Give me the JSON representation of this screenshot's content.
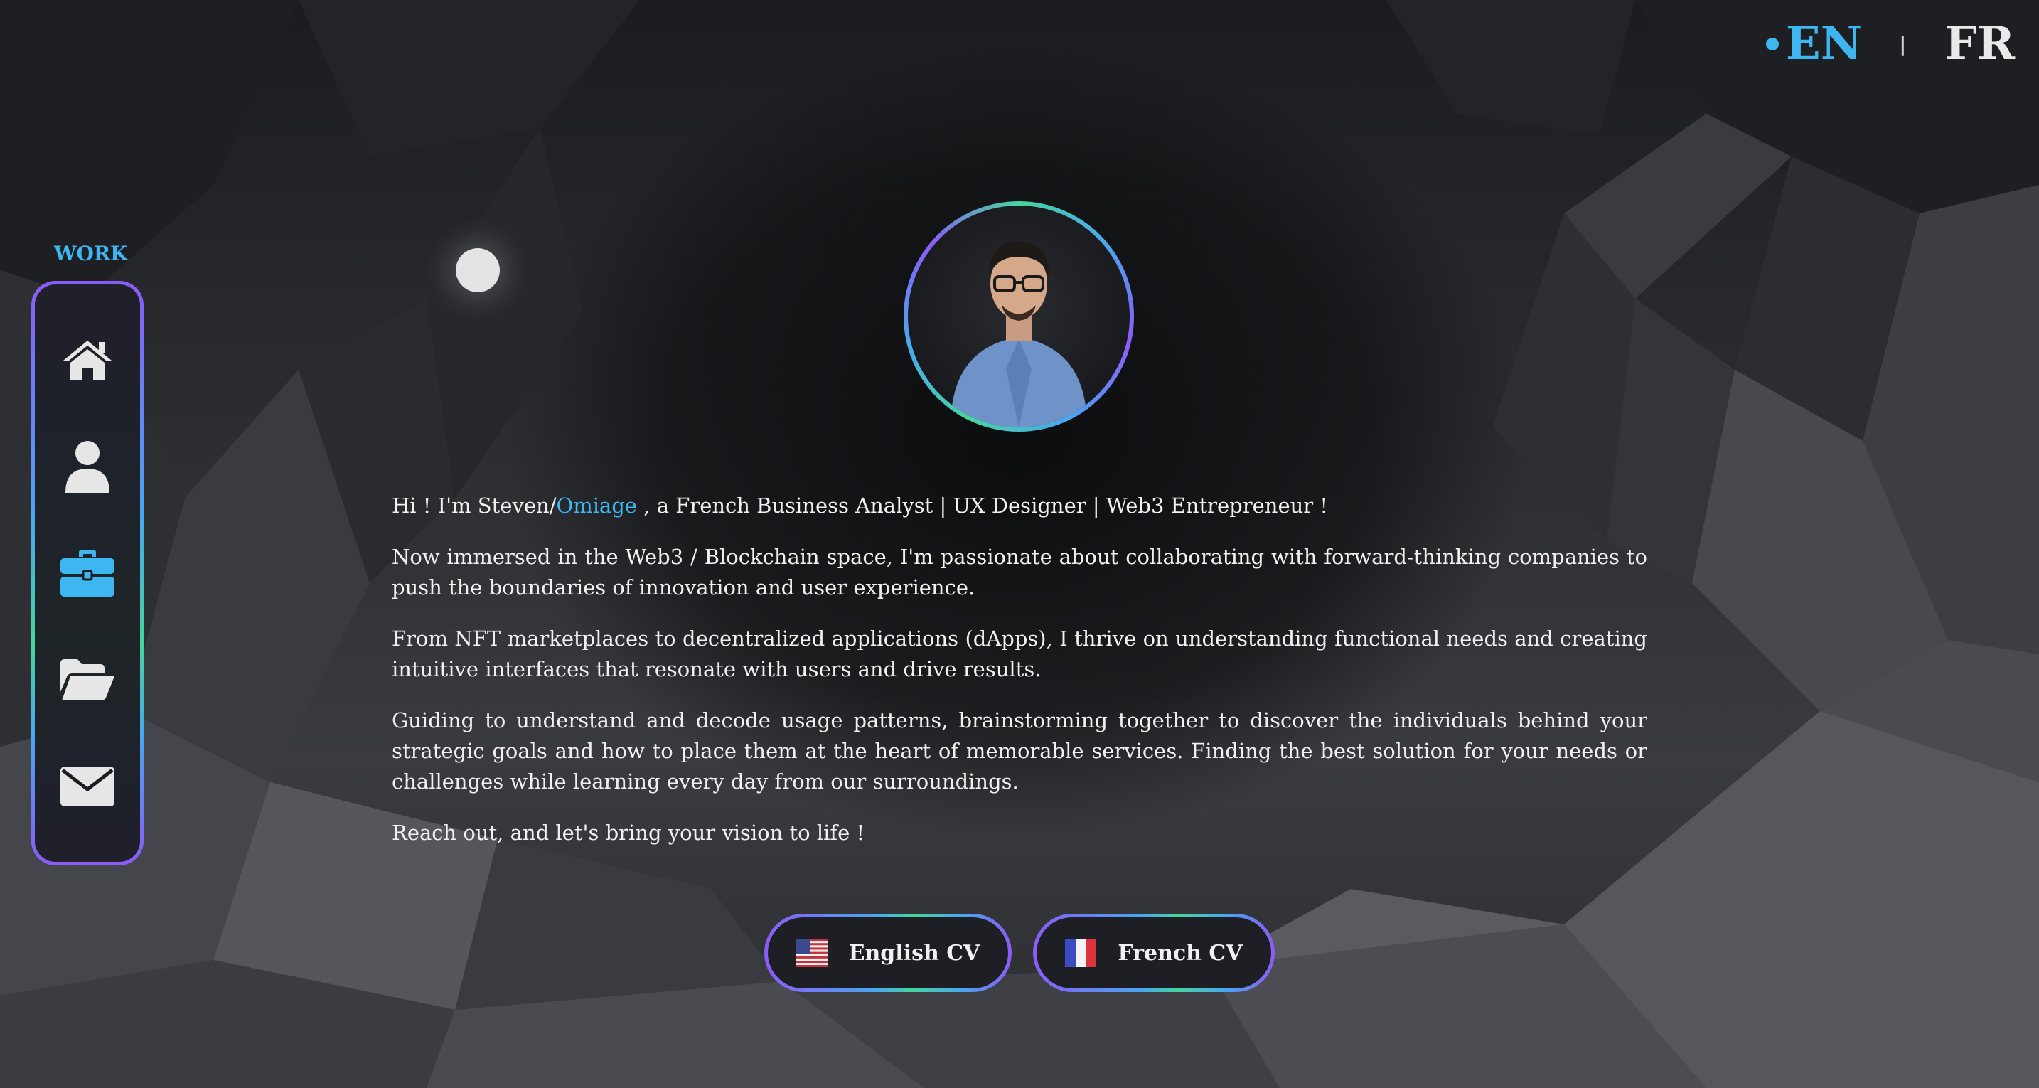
{
  "language_switch": {
    "active": "EN",
    "other": "FR"
  },
  "sidebar": {
    "section_label": "WORK",
    "items": [
      {
        "name": "home",
        "icon": "home-icon",
        "active": false
      },
      {
        "name": "about",
        "icon": "user-icon",
        "active": false
      },
      {
        "name": "work",
        "icon": "briefcase-icon",
        "active": true
      },
      {
        "name": "portfolio",
        "icon": "folder-open-icon",
        "active": false
      },
      {
        "name": "contact",
        "icon": "envelope-icon",
        "active": false
      }
    ]
  },
  "bio": {
    "intro_prefix": "Hi ! I'm Steven/",
    "intro_name": "Omiage",
    "intro_suffix": " , a French Business Analyst | UX Designer | Web3 Entrepreneur !",
    "paragraph_2": "Now immersed in the Web3 / Blockchain space, I'm passionate about collaborating with forward-thinking companies to push the boundaries of innovation and user experience.",
    "paragraph_3": "From NFT marketplaces to decentralized applications (dApps), I thrive on understanding functional needs and creating intuitive interfaces that resonate with users and drive results.",
    "paragraph_4": "Guiding to understand and decode usage patterns, brainstorming together to discover the individuals behind your strategic goals and how to place them at the heart of memorable services. Finding the best solution for your needs or challenges while learning every day from our surroundings.",
    "paragraph_5": "Reach out, and let's bring your vision to life !"
  },
  "buttons": {
    "english_cv": "English CV",
    "french_cv": "French CV"
  },
  "colors": {
    "accent": "#3eb6f1",
    "gradient_purple": "#8a5cf6",
    "gradient_green": "#46d5a0",
    "icon_default": "#e6e6e6"
  }
}
